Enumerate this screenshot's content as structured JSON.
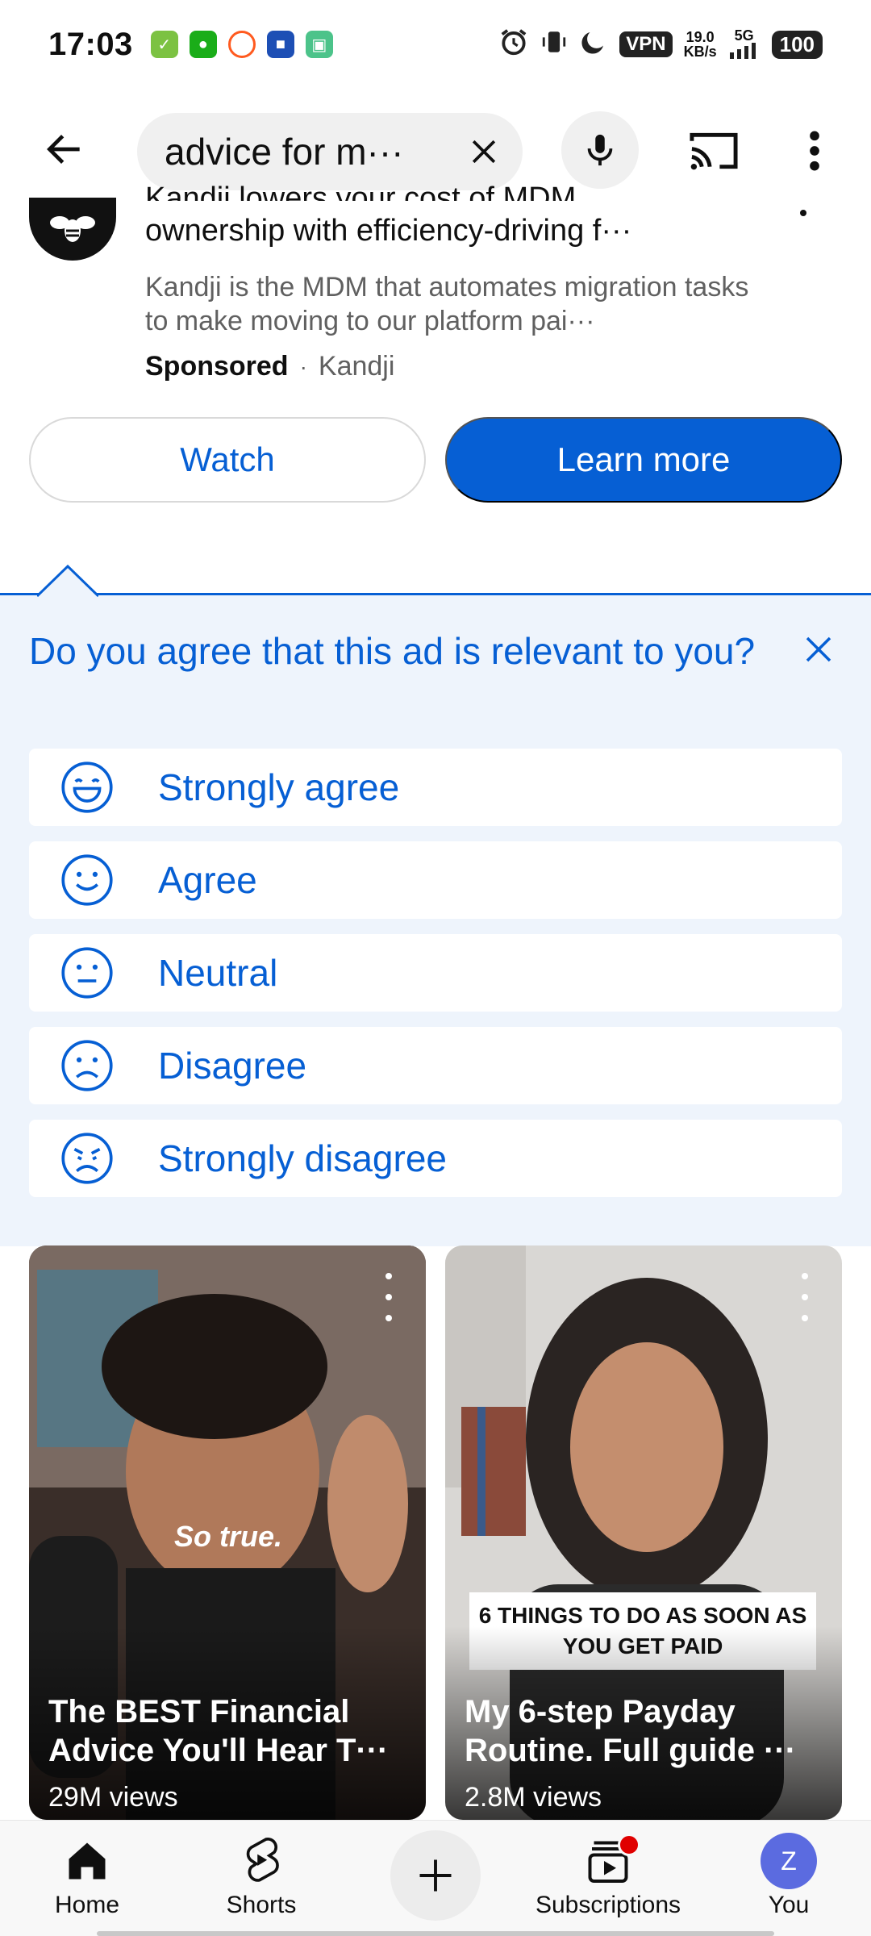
{
  "status_bar": {
    "time": "17:03",
    "vpn": "VPN",
    "speed_value": "19.0",
    "speed_unit": "KB/s",
    "network": "5G",
    "battery": "100"
  },
  "search": {
    "query": "advice for m···"
  },
  "ad": {
    "title": "ownership with efficiency-driving f···",
    "title_cut": "Kandji lowers your cost of MDM",
    "description": "Kandji is the MDM that automates migration tasks to make moving to our platform pai···",
    "sponsored": "Sponsored",
    "separator": "·",
    "advertiser": "Kandji",
    "watch_label": "Watch",
    "learn_more_label": "Learn more"
  },
  "survey": {
    "question": "Do you agree that this ad is relevant to you?",
    "options": [
      {
        "label": "Strongly agree"
      },
      {
        "label": "Agree"
      },
      {
        "label": "Neutral"
      },
      {
        "label": "Disagree"
      },
      {
        "label": "Strongly disagree"
      }
    ]
  },
  "videos": [
    {
      "title": "The BEST Financial Advice You'll Hear T···",
      "views": "29M views",
      "caption": "So true."
    },
    {
      "title": "My 6-step Payday Routine. Full guide ···",
      "views": "2.8M views",
      "banner": "6 THINGS TO DO AS SOON AS YOU GET PAID"
    }
  ],
  "bottom_nav": {
    "home": "Home",
    "shorts": "Shorts",
    "subscriptions": "Subscriptions",
    "you": "You",
    "avatar_letter": "Z"
  },
  "colors": {
    "accent": "#065fd4",
    "survey_bg": "#eef4fc",
    "notification": "#e00000",
    "avatar": "#5b6be0"
  },
  "icons": [
    "back-arrow-icon",
    "close-icon",
    "microphone-icon",
    "cast-icon",
    "more-vert-icon",
    "smiley-icon",
    "home-icon",
    "shorts-icon",
    "plus-icon",
    "subscriptions-icon"
  ]
}
